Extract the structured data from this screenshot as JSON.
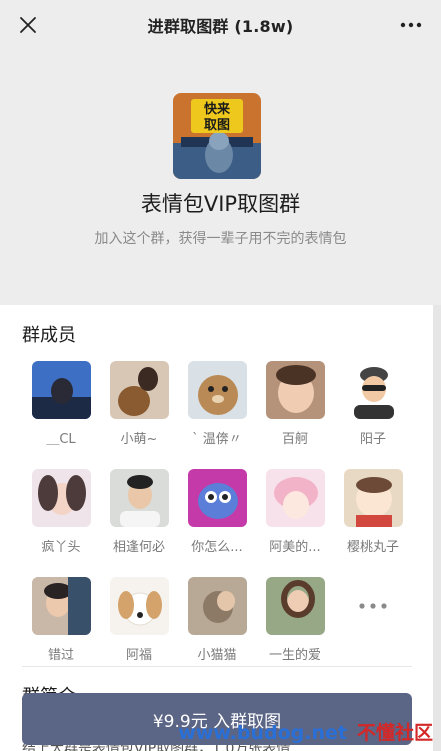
{
  "nav": {
    "title": "进群取图群 (1.8w)",
    "close_icon": "close-icon",
    "more_icon": "more-icon"
  },
  "group": {
    "name": "表情包VIP取图群",
    "subtitle": "加入这个群，获得一辈子用不完的表情包",
    "avatar_text_1": "快来",
    "avatar_text_2": "取图"
  },
  "members_section": {
    "title": "群成员",
    "members": [
      {
        "name": "＿CL"
      },
      {
        "name": "小萌~"
      },
      {
        "name": "` 温倴〃"
      },
      {
        "name": "百舸"
      },
      {
        "name": "阳子"
      },
      {
        "name": "疯丫头"
      },
      {
        "name": "相逢何必"
      },
      {
        "name": "你怎么..."
      },
      {
        "name": "阿美的..."
      },
      {
        "name": "樱桃丸子"
      },
      {
        "name": "错过"
      },
      {
        "name": "阿福"
      },
      {
        "name": "小猫猫"
      },
      {
        "name": "一生的爱"
      }
    ]
  },
  "intro": {
    "title": "群简介",
    "text": "结上大群是表情包VIP取图群，1.0万张表情"
  },
  "join_button": {
    "label": "¥9.9元 入群取图"
  },
  "watermark": {
    "site": "www.budog.net",
    "name": "不懂社区"
  },
  "colors": {
    "accent": "#5b6586",
    "background": "#ededed"
  }
}
